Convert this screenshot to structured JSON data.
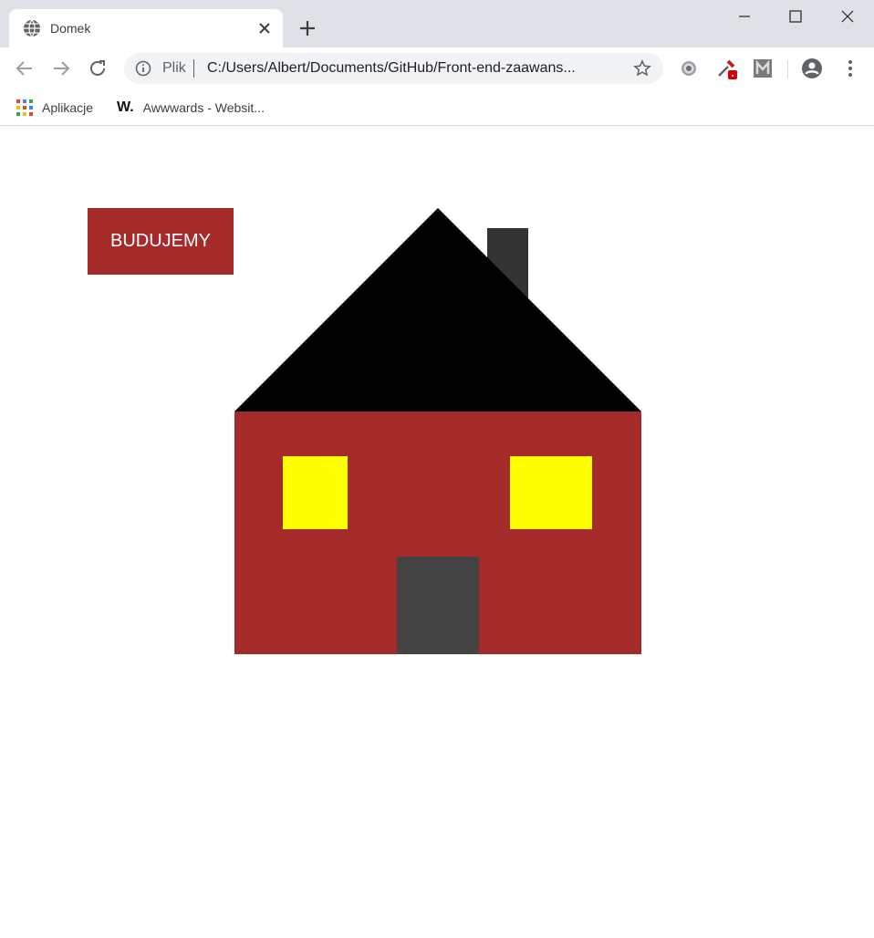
{
  "browser": {
    "tab": {
      "title": "Domek"
    },
    "omnibox": {
      "scheme": "Plik",
      "url": "C:/Users/Albert/Documents/GitHub/Front-end-zaawans..."
    },
    "bookmarks": [
      {
        "label": "Aplikacje",
        "icon": "apps-icon"
      },
      {
        "label": "Awwwards - Websit...",
        "icon": "awwwards-icon"
      }
    ]
  },
  "page": {
    "button_label": "BUDUJEMY",
    "colors": {
      "wall": "#a52a2a",
      "roof": "#000000",
      "chimney": "#333333",
      "window": "#ffff00",
      "door": "#444444",
      "button_bg": "#a52a2a",
      "button_text": "#ffffff"
    }
  }
}
